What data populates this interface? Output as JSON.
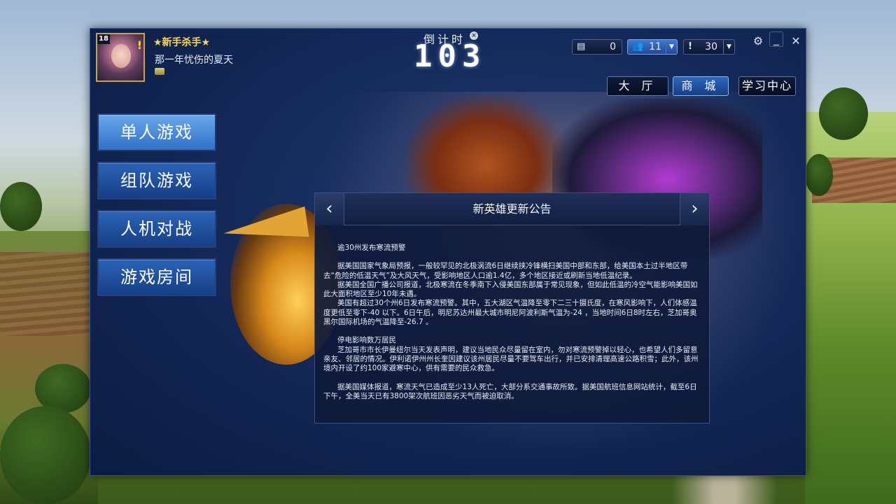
{
  "user": {
    "level": "18",
    "title": "★新手杀手★",
    "name": "那一年忧伤的夏天"
  },
  "countdown": {
    "label": "倒计时",
    "close_icon": "×",
    "value": "103"
  },
  "counters": {
    "messages": {
      "icon": "chat-icon",
      "value": "0"
    },
    "friends": {
      "icon": "user-icon",
      "value": "11"
    },
    "alerts": {
      "icon": "alert-icon",
      "value": "30"
    }
  },
  "window_buttons": {
    "settings": "⚙",
    "minimize": "_",
    "close": "✕"
  },
  "tabs": [
    {
      "label": "大 厅"
    },
    {
      "label": "商 城"
    },
    {
      "label": "学习中心"
    }
  ],
  "menu": [
    {
      "label": "单人游戏"
    },
    {
      "label": "组队游戏"
    },
    {
      "label": "人机对战"
    },
    {
      "label": "游戏房间"
    }
  ],
  "notice": {
    "title": "新英雄更新公告",
    "prev": "‹",
    "next": "›",
    "paragraphs": [
      "      逾30州发布寒流预警",
      "",
      "      据美国国家气象局预报，一般较罕见的北极涡流6日继续挟冷锋横扫美国中部和东部，给美国本土过半地区带去“危险的低温天气”及大风天气，受影响地区人口逾1.4亿，多个地区接近或刷新当地低温纪录。",
      "      据美国全国广播公司报道，北极寒流在冬季南下入侵美国东部属于常见现象，但如此低温的冷空气能影响美国如此大面积地区至少10年未遇。",
      "      美国有超过30个州6日发布寒流预警。其中，五大湖区气温降至零下二三十摄氏度，在寒风影响下，人们体感温度更低至零下-40 以下。6日午后，明尼苏达州最大城市明尼阿波利斯气温为-24 ，当地时间6日8时左右，芝加哥奥黑尔国际机场的气温降至-26.7 。",
      "",
      "      停电影响数万居民",
      "      芝加哥市市长伊曼纽尔当天发表声明，建议当地民众尽量留在室内，勿对寒流预警掉以轻心，也希望人们多留意亲友、邻居的情况。伊利诺伊州州长奎因建议该州居民尽量不要驾车出行，并已安排清理高速公路积雪；此外，该州境内开设了约100家避寒中心，供有需要的民众救急。",
      "",
      "      据美国媒体报道，寒流天气已造成至少13人死亡，大部分系交通事故所致。据美国航班信息网站统计，截至6日下午，全美当天已有3800架次航班因恶劣天气而被迫取消。"
    ]
  }
}
